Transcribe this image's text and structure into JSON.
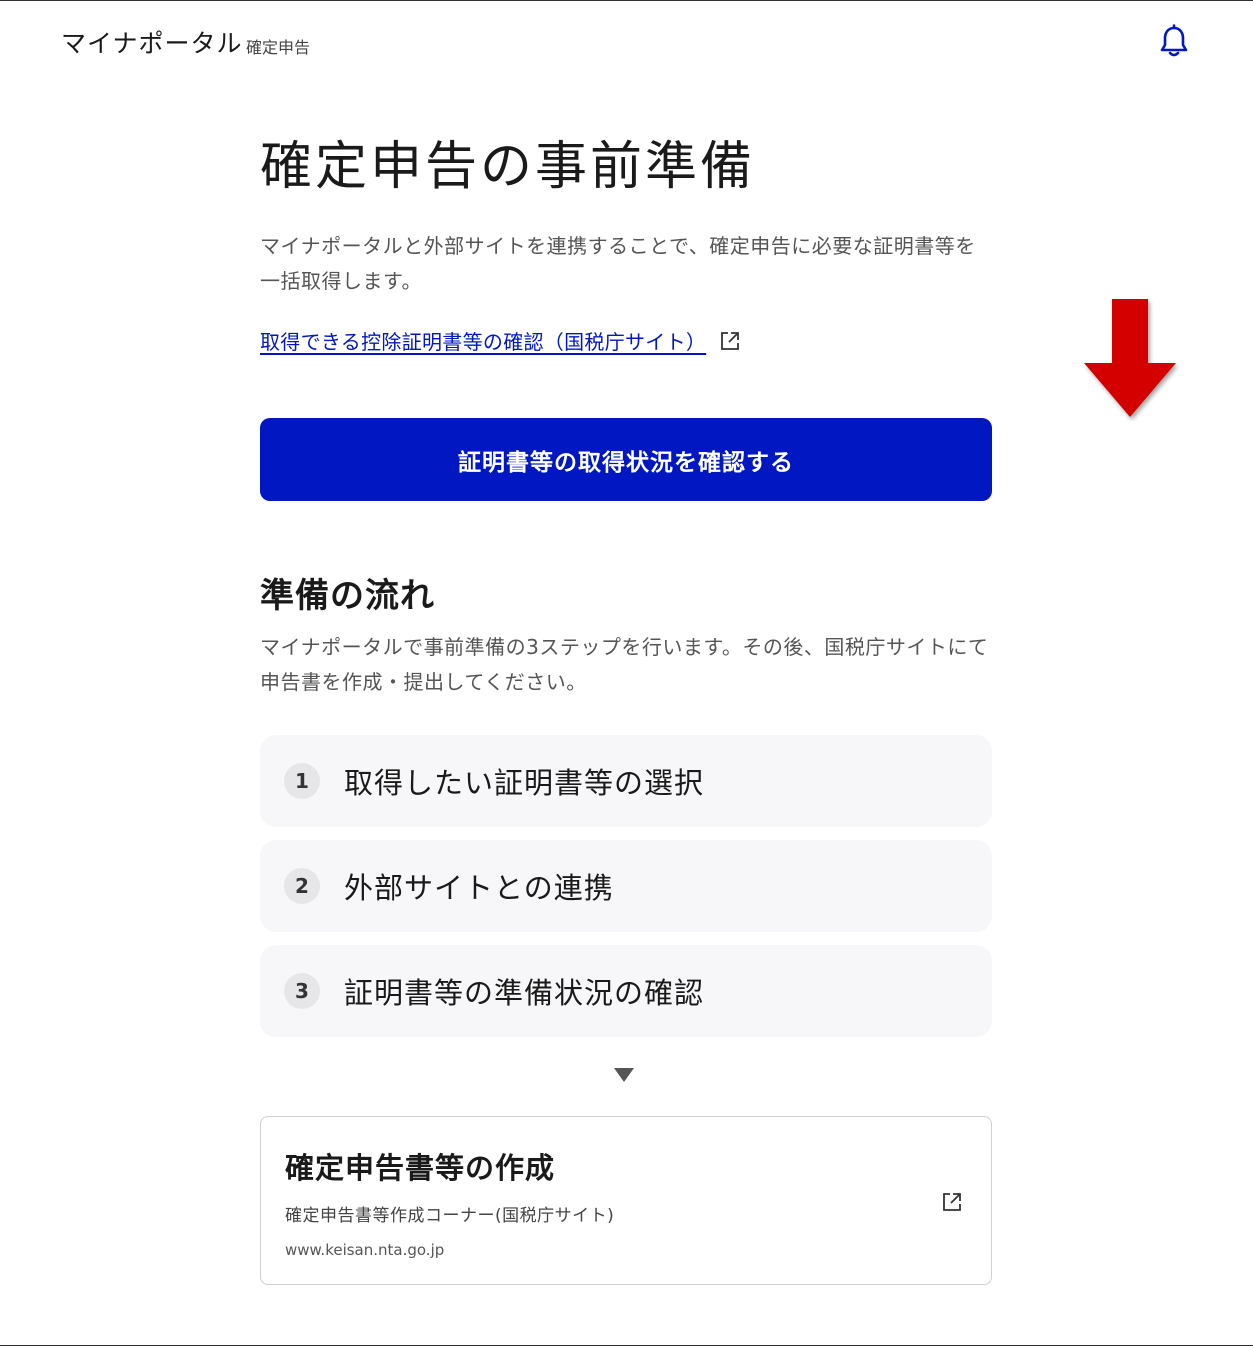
{
  "header": {
    "brand": "マイナポータル",
    "brand_sub": "確定申告",
    "bell_icon": "bell-icon"
  },
  "page": {
    "title": "確定申告の事前準備",
    "description": "マイナポータルと外部サイトを連携することで、確定申告に必要な証明書等を一括取得します。",
    "link_label": "取得できる控除証明書等の確認（国税庁サイト）",
    "cta_label": "証明書等の取得状況を確認する"
  },
  "flow": {
    "title": "準備の流れ",
    "description": "マイナポータルで事前準備の3ステップを行います。その後、国税庁サイトにて申告書を作成・提出してください。",
    "steps": [
      {
        "num": "1",
        "label": "取得したい証明書等の選択"
      },
      {
        "num": "2",
        "label": "外部サイトとの連携"
      },
      {
        "num": "3",
        "label": "証明書等の準備状況の確認"
      }
    ]
  },
  "card": {
    "title": "確定申告書等の作成",
    "subtitle": "確定申告書等作成コーナー(国税庁サイト)",
    "url": "www.keisan.nta.go.jp"
  },
  "colors": {
    "primary": "#0017c1",
    "annotation_arrow": "#d40000",
    "step_bg": "#f7f7f9"
  }
}
